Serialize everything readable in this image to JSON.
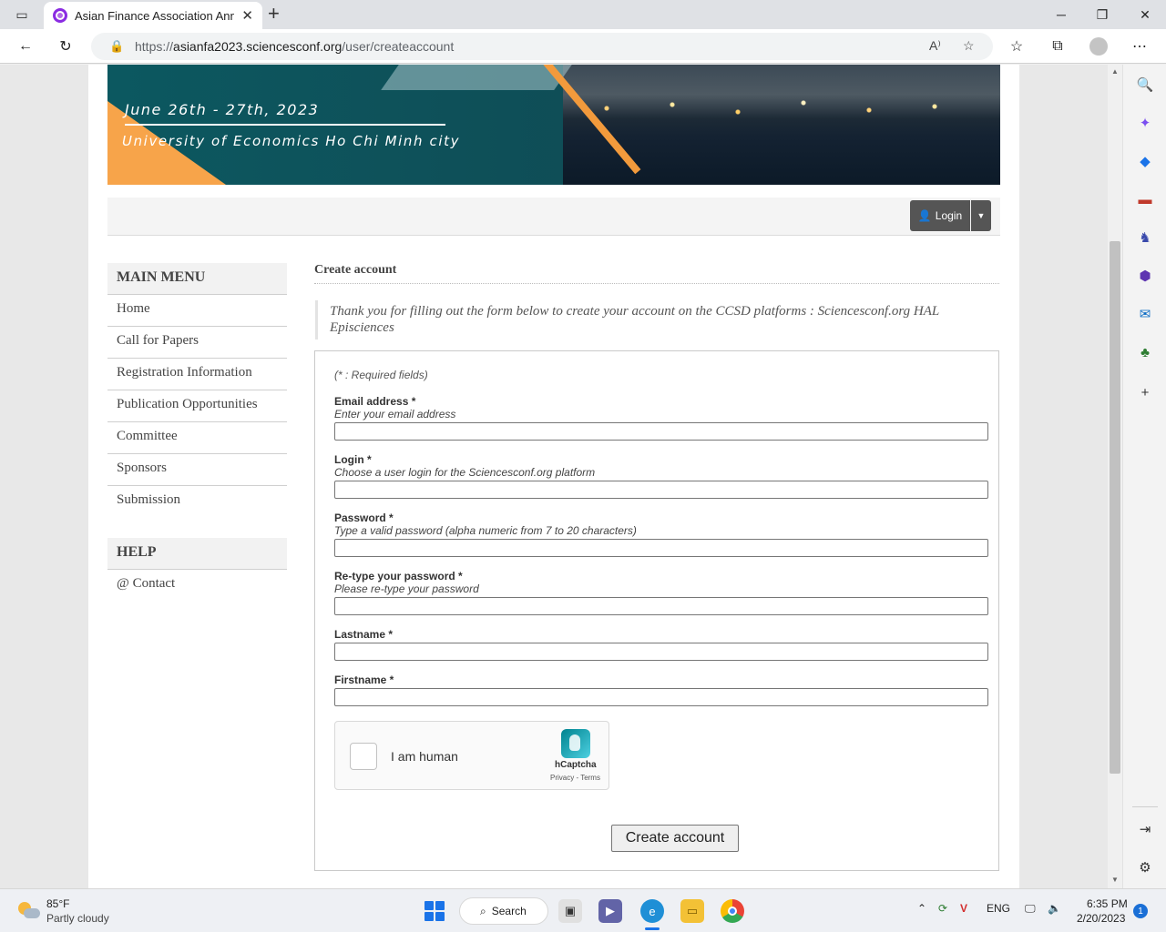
{
  "browser": {
    "tab_title": "Asian Finance Association Annual",
    "url_scheme": "https://",
    "url_host": "asianfa2023.sciencesconf.org",
    "url_path": "/user/createaccount"
  },
  "banner": {
    "date": "June 26th - 27th, 2023",
    "university": "University of Economics Ho Chi Minh city"
  },
  "userbar": {
    "login_label": "Login"
  },
  "sidebar": {
    "main_menu_title": "MAIN MENU",
    "items": [
      "Home",
      "Call for Papers",
      "Registration Information",
      "Publication Opportunities",
      "Committee",
      "Sponsors",
      "Submission"
    ],
    "help_title": "HELP",
    "help_items": [
      "@ Contact"
    ]
  },
  "main": {
    "title": "Create account",
    "intro": "Thank you for filling out the form below to create your account on the CCSD platforms : Sciencesconf.org HAL Episciences"
  },
  "form": {
    "required_note": "(* : Required fields)",
    "email_label": "Email address *",
    "email_hint": "Enter your email address",
    "login_label": "Login *",
    "login_hint": "Choose a user login for the Sciencesconf.org platform",
    "password_label": "Password *",
    "password_hint": "Type a valid password (alpha numeric from 7 to 20 characters)",
    "retype_label": "Re-type your password *",
    "retype_hint": "Please re-type your password",
    "lastname_label": "Lastname *",
    "firstname_label": "Firstname *",
    "captcha_text": "I am human",
    "captcha_brand": "hCaptcha",
    "captcha_links": "Privacy - Terms",
    "submit_label": "Create account"
  },
  "taskbar": {
    "temperature": "85°F",
    "condition": "Partly cloudy",
    "search_label": "Search",
    "language": "ENG",
    "time": "6:35 PM",
    "date": "2/20/2023",
    "notification_count": "1"
  }
}
